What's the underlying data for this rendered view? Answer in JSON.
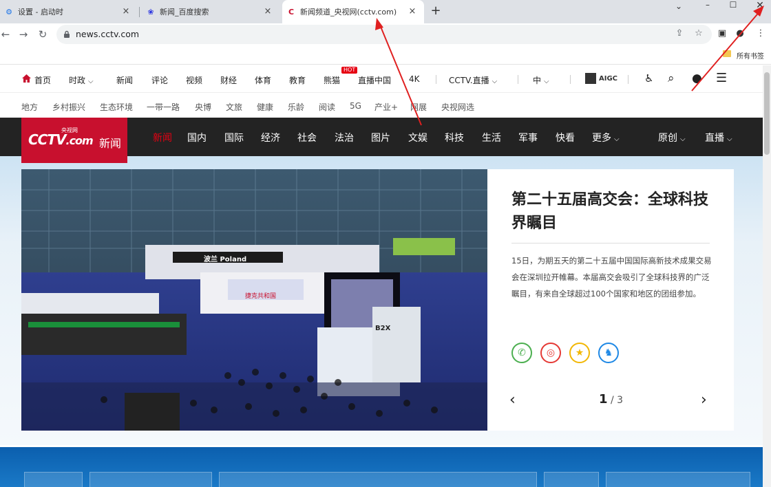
{
  "browser": {
    "tabs": [
      {
        "title": "设置 - 启动时",
        "icon": "gear-icon"
      },
      {
        "title": "新闻_百度搜索",
        "icon": "baidu-paw-icon"
      },
      {
        "title": "新闻频道_央视网(cctv.com)",
        "icon": "cctv-icon",
        "active": true
      }
    ],
    "url": "news.cctv.com",
    "bookmarks_label": "所有书签"
  },
  "topnav": {
    "home": "首页",
    "items": [
      "时政",
      "新闻",
      "评论",
      "视频",
      "财经",
      "体育",
      "教育",
      "熊猫",
      "直播中国",
      "4K"
    ],
    "hot_badge": "HOT",
    "live": "CCTV.直播",
    "lang": "中",
    "aigc": "AIGC"
  },
  "subnav": [
    "地方",
    "乡村振兴",
    "生态环境",
    "一带一路",
    "央博",
    "文旅",
    "健康",
    "乐龄",
    "阅读",
    "5G",
    "产业+",
    "网展",
    "央视网选"
  ],
  "logo": {
    "cctv": "CCTV",
    "com": ".com",
    "cn": "央视网",
    "section": "新闻"
  },
  "mainnav": {
    "items": [
      "新闻",
      "国内",
      "国际",
      "经济",
      "社会",
      "法治",
      "图片",
      "文娱",
      "科技",
      "生活",
      "军事",
      "快看"
    ],
    "more": "更多",
    "original": "原创",
    "live": "直播"
  },
  "hero": {
    "title": "第二十五届高交会：全球科技界瞩目",
    "desc": "15日，为期五天的第二十五届中国国际高新技术成果交易会在深圳拉开帷幕。本届高交会吸引了全球科技界的广泛瞩目，有来自全球超过100个国家和地区的团组参加。",
    "image_signs": [
      "波兰 Poland",
      "捷克共和国",
      "B2X"
    ],
    "pager_current": "1",
    "pager_total": "/ 3"
  },
  "colors": {
    "brand_red": "#c8102e",
    "nav_dark": "#232323",
    "wechat": "#4caf50",
    "weibo": "#e53935",
    "star": "#f2b705",
    "qq": "#1e88e5",
    "arrow": "#e02020"
  }
}
